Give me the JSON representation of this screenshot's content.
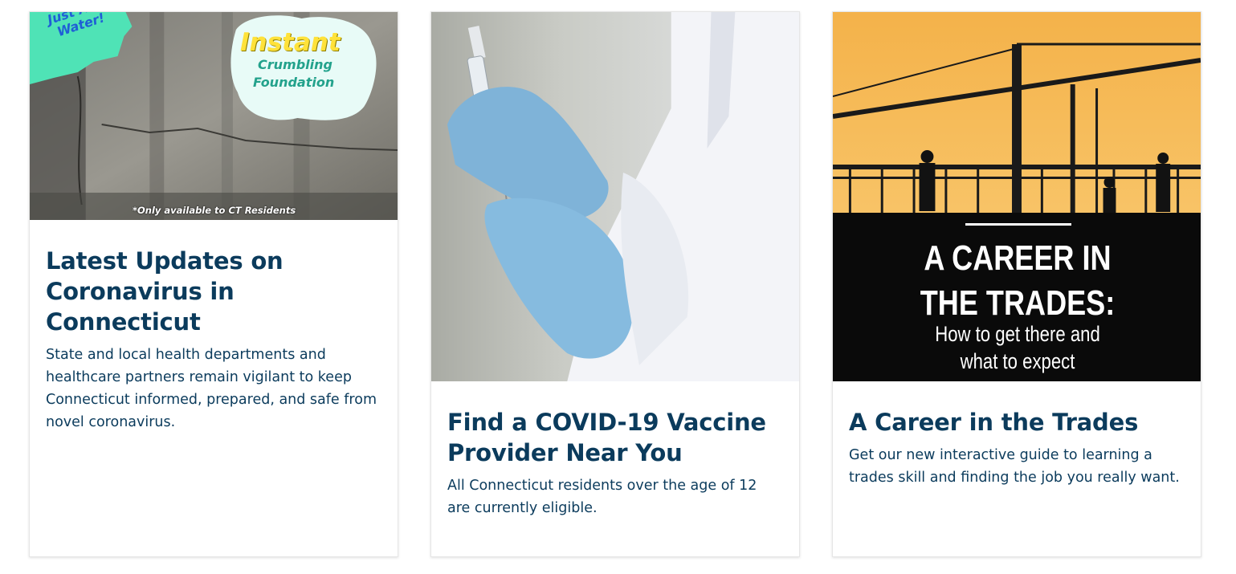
{
  "cards": [
    {
      "title": "Latest Updates on Coronavirus in Connecticut",
      "description": "State and local health departments and healthcare partners remain vigilant to keep Connecticut informed, prepared, and safe from novel coronavirus.",
      "image_text": {
        "badge": "Just Add Water!",
        "instant": "Instant",
        "crumbling": "Crumbling",
        "foundation": "Foundation",
        "note": "*Only available to CT Residents"
      }
    },
    {
      "title": "Find a COVID-19 Vaccine Provider Near You",
      "description": "All Connecticut residents over the age of 12 are currently eligible."
    },
    {
      "title": "A Career in the Trades",
      "description": "Get our new interactive guide to learning a trades skill and finding the job you really want.",
      "image_text": {
        "line1": "A CAREER IN",
        "line2": "THE TRADES:",
        "line3": "How to get there and",
        "line4": "what to expect"
      }
    }
  ],
  "colors": {
    "heading": "#0b3b5c",
    "card_border": "#e6e6e6",
    "sky": "#f7c062"
  }
}
